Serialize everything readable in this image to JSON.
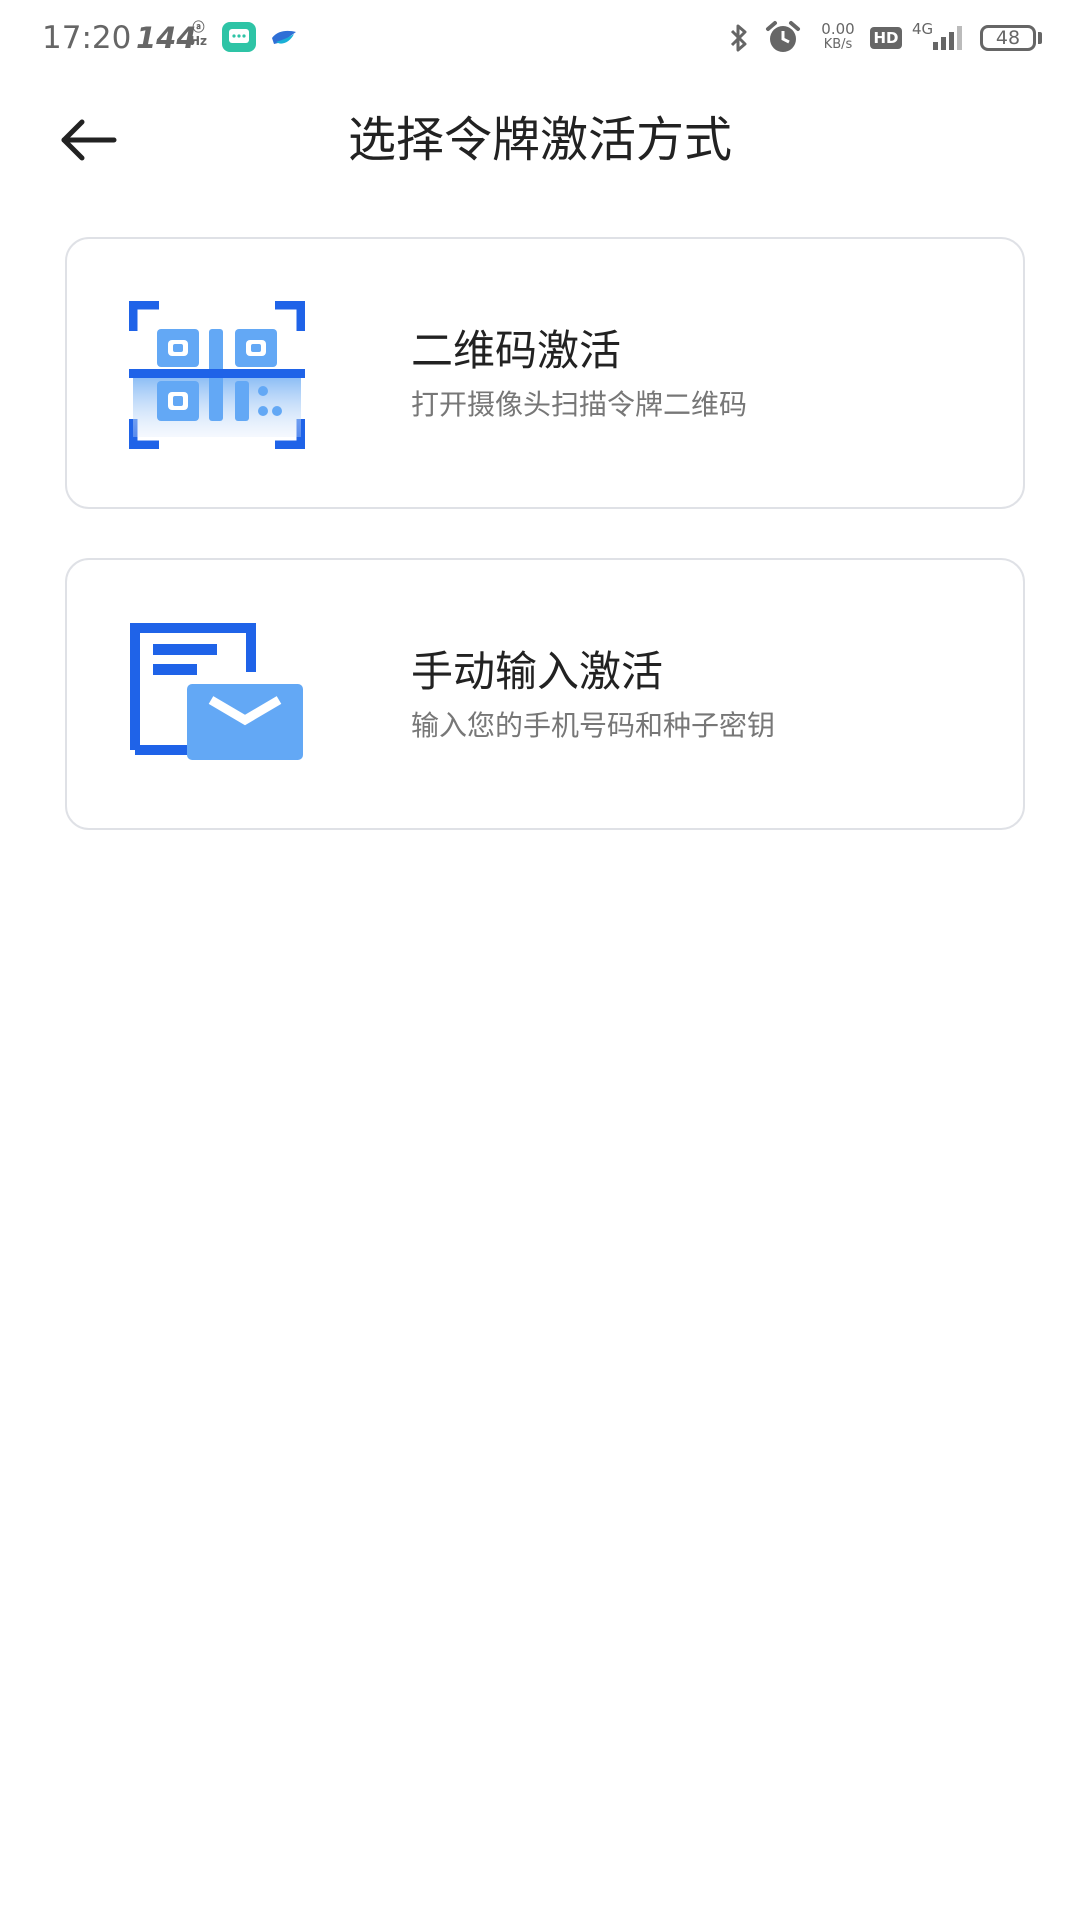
{
  "status_bar": {
    "time": "17:20",
    "refresh_rate": "144",
    "refresh_rate_unit": "Hz",
    "net_speed_value": "0.00",
    "net_speed_unit": "KB/s",
    "hd_label": "HD",
    "network_type": "4G",
    "battery_level": "48",
    "icons": [
      "message-app-icon",
      "bird-app-icon",
      "bluetooth-icon",
      "alarm-icon",
      "signal-icon",
      "battery-icon"
    ]
  },
  "header": {
    "back_icon": "arrow-left-icon",
    "title": "选择令牌激活方式"
  },
  "options": [
    {
      "icon": "qr-scan-icon",
      "title": "二维码激活",
      "subtitle": "打开摄像头扫描令牌二维码"
    },
    {
      "icon": "manual-entry-icon",
      "title": "手动输入激活",
      "subtitle": "输入您的手机号码和种子密钥"
    }
  ],
  "colors": {
    "accent_blue": "#1f63e8",
    "light_blue": "#63a8f5",
    "card_border": "#dfe1e6",
    "title_text": "#222222",
    "subtitle_text": "#777777",
    "status_text": "#666666"
  }
}
